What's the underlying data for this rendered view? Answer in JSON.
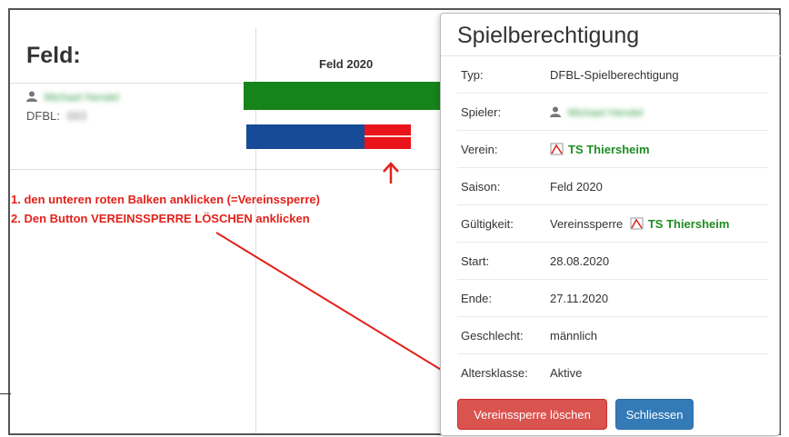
{
  "background": {
    "section_title": "Feld:",
    "column_header": "Feld 2020",
    "player": {
      "name_blurred": "Michael Hendel",
      "dfbl_label": "DFBL:",
      "dfbl_number_blurred": "683"
    },
    "colors": {
      "bar_green": "#15851b",
      "bar_blue": "#174a97",
      "bar_red": "#e8141a",
      "annotation_red": "#e3211a"
    }
  },
  "instructions": {
    "line1": "1. den unteren roten Balken anklicken (=Vereinssperre)",
    "line2": "2. Den Button VEREINSSPERRE LÖSCHEN anklicken"
  },
  "modal": {
    "title": "Spielberechtigung",
    "rows": [
      {
        "label": "Typ:",
        "value": "DFBL-Spielberechtigung"
      },
      {
        "label": "Spieler:",
        "value": "Michael Hendel",
        "icon": "user-icon",
        "blurred": true
      },
      {
        "label": "Verein:",
        "value": "TS Thiersheim",
        "icon": "club-logo-icon"
      },
      {
        "label": "Saison:",
        "value": "Feld 2020"
      },
      {
        "label": "Gültigkeit:",
        "value": "Vereinssperre",
        "club": "TS Thiersheim",
        "icon": "club-logo-icon"
      },
      {
        "label": "Start:",
        "value": "28.08.2020"
      },
      {
        "label": "Ende:",
        "value": "27.11.2020"
      },
      {
        "label": "Geschlecht:",
        "value": "männlich"
      },
      {
        "label": "Altersklasse:",
        "value": "Aktive"
      }
    ],
    "buttons": {
      "delete_lock": "Vereinssperre löschen",
      "close": "Schliessen"
    },
    "colors": {
      "club_name": "#1e8c22",
      "btn_danger": "#d9534f",
      "btn_primary": "#337ab7"
    }
  }
}
